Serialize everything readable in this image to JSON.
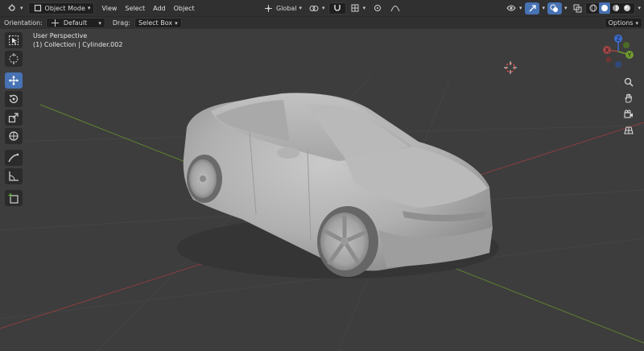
{
  "header": {
    "mode_label": "Object Mode",
    "menus": [
      "View",
      "Select",
      "Add",
      "Object"
    ],
    "transform_orientation": "Global"
  },
  "subheader": {
    "orientation_label": "Orientation:",
    "orientation_value": "Default",
    "drag_label": "Drag:",
    "drag_value": "Select Box",
    "options_label": "Options"
  },
  "viewport": {
    "view_name": "User Perspective",
    "collection_info": "(1) Collection | Cylinder.002"
  },
  "gizmo": {
    "axes": [
      "Z",
      "Y",
      "X"
    ]
  },
  "colors": {
    "accent": "#4772b3",
    "x_axis": "#a04646",
    "y_axis": "#6f9a30",
    "z_axis": "#3c6ecf"
  },
  "icons": {
    "toolbar": [
      "select-box-icon",
      "cursor-icon",
      "move-icon",
      "rotate-icon",
      "scale-icon",
      "transform-icon",
      "annotate-icon",
      "measure-icon",
      "add-cube-icon"
    ],
    "navigation": [
      "zoom-icon",
      "hand-icon",
      "camera-icon",
      "grid-icon"
    ]
  }
}
